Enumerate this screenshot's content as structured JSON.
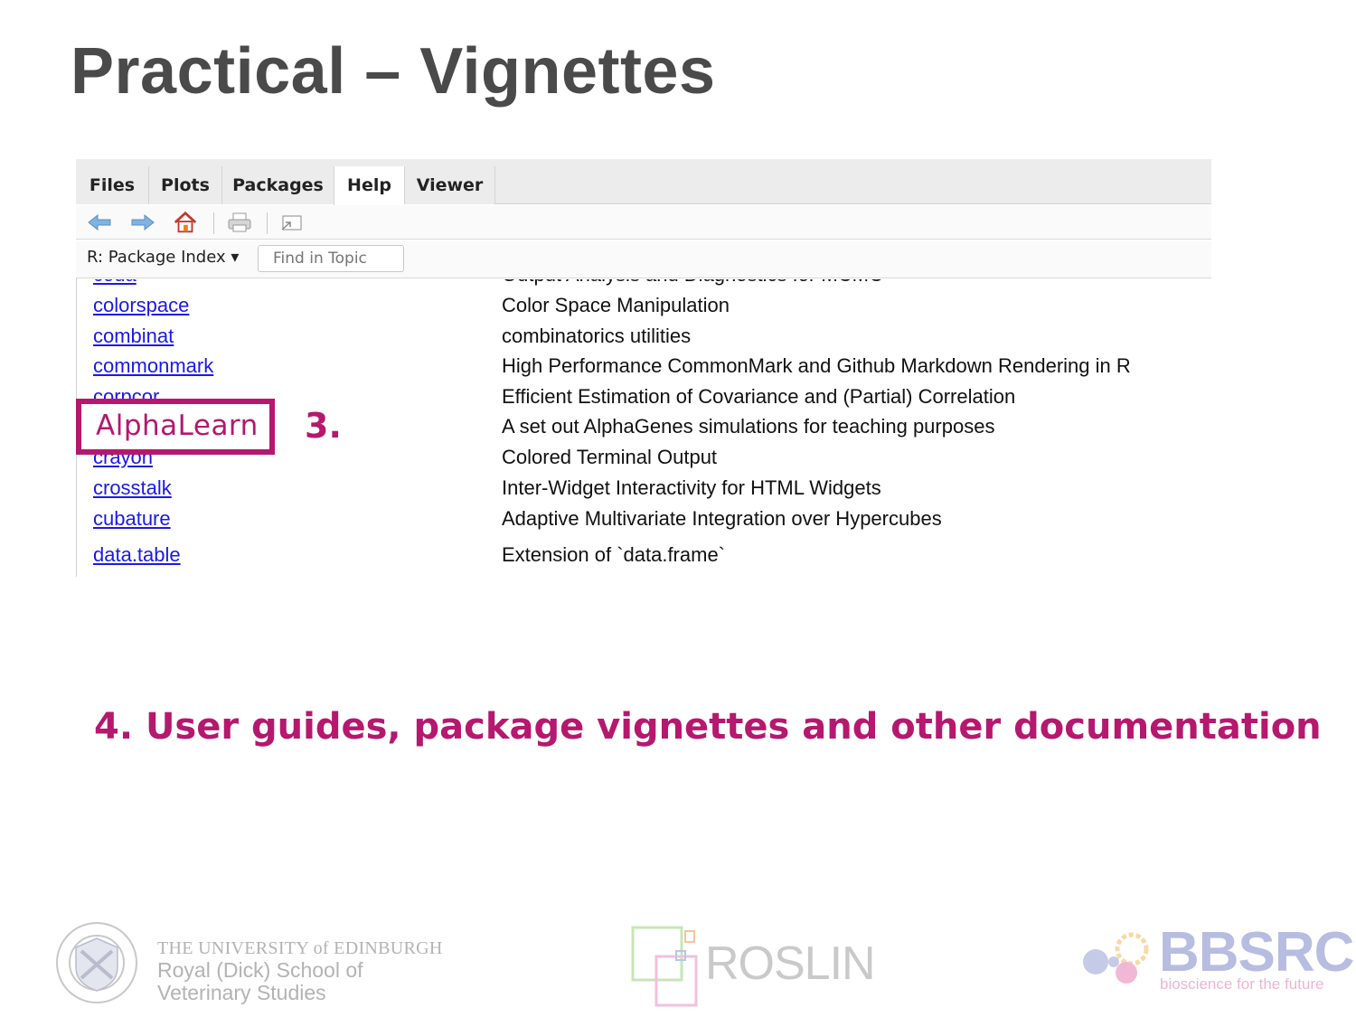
{
  "slide": {
    "title": "Practical – Vignettes",
    "step3_label": "3.",
    "highlight_label": "AlphaLearn",
    "step4_text": "4. User guides, package vignettes and other documentation"
  },
  "tabs": [
    "Files",
    "Plots",
    "Packages",
    "Help",
    "Viewer"
  ],
  "active_tab": "Help",
  "toolbar": {
    "icons": [
      "back-arrow-icon",
      "forward-arrow-icon",
      "home-icon",
      "print-icon",
      "popout-icon"
    ]
  },
  "topic_bar": {
    "select_label": "R: Package Index ▾",
    "find_placeholder": "Find in Topic"
  },
  "packages": [
    {
      "name": "coda",
      "desc": "Output Analysis and Diagnostics for MCMC"
    },
    {
      "name": "colorspace",
      "desc": "Color Space Manipulation"
    },
    {
      "name": "combinat",
      "desc": "combinatorics utilities"
    },
    {
      "name": "commonmark",
      "desc": "High Performance CommonMark and Github Markdown Rendering in R"
    },
    {
      "name": "corpcor",
      "desc": "Efficient Estimation of Covariance and (Partial) Correlation"
    },
    {
      "name": "AlphaLearn",
      "desc": "A set out AlphaGenes simulations for teaching purposes"
    },
    {
      "name": "crayon",
      "desc": "Colored Terminal Output"
    },
    {
      "name": "crosstalk",
      "desc": "Inter-Widget Interactivity for HTML Widgets"
    },
    {
      "name": "cubature",
      "desc": "Adaptive Multivariate Integration over Hypercubes"
    },
    {
      "name": "data.table",
      "desc": "Extension of `data.frame`"
    }
  ],
  "footer": {
    "uoe_line1": "THE UNIVERSITY of EDINBURGH",
    "uoe_line2": "Royal (Dick) School of",
    "uoe_line3": "Veterinary Studies",
    "roslin": "ROSLIN",
    "bbsrc": "BBSRC",
    "bbsrc_tagline": "bioscience for the future"
  },
  "colors": {
    "accent": "#b5186e",
    "link": "#1a1ae6",
    "title": "#4a4a4a"
  }
}
